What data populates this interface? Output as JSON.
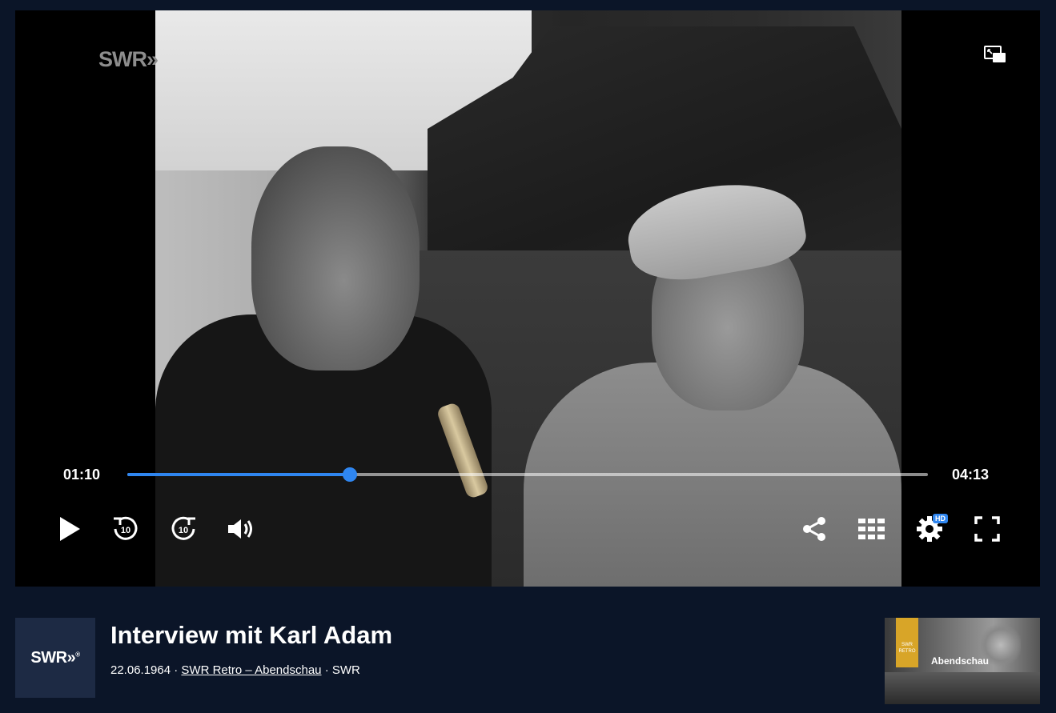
{
  "player": {
    "watermark": "SWR",
    "current_time": "01:10",
    "total_time": "04:13",
    "progress_fraction": 0.278,
    "accent_color": "#2f86f0",
    "hd_badge": "HD",
    "controls": {
      "play": "play-icon",
      "rewind": "rewind-10-icon",
      "forward": "forward-10-icon",
      "volume": "volume-icon",
      "share": "share-icon",
      "chapters": "grid-icon",
      "settings": "gear-icon",
      "fullscreen": "fullscreen-icon",
      "pip": "picture-in-picture-icon"
    },
    "skip_seconds": "10"
  },
  "video_info": {
    "channel_logo": "SWR",
    "title": "Interview mit Karl Adam",
    "date": "22.06.1964",
    "separator": "·",
    "series_link": "SWR Retro – Abendschau",
    "broadcaster": "SWR"
  },
  "thumbnail": {
    "ribbon_text": "SWR RETRO",
    "show_name": "Abendschau"
  }
}
